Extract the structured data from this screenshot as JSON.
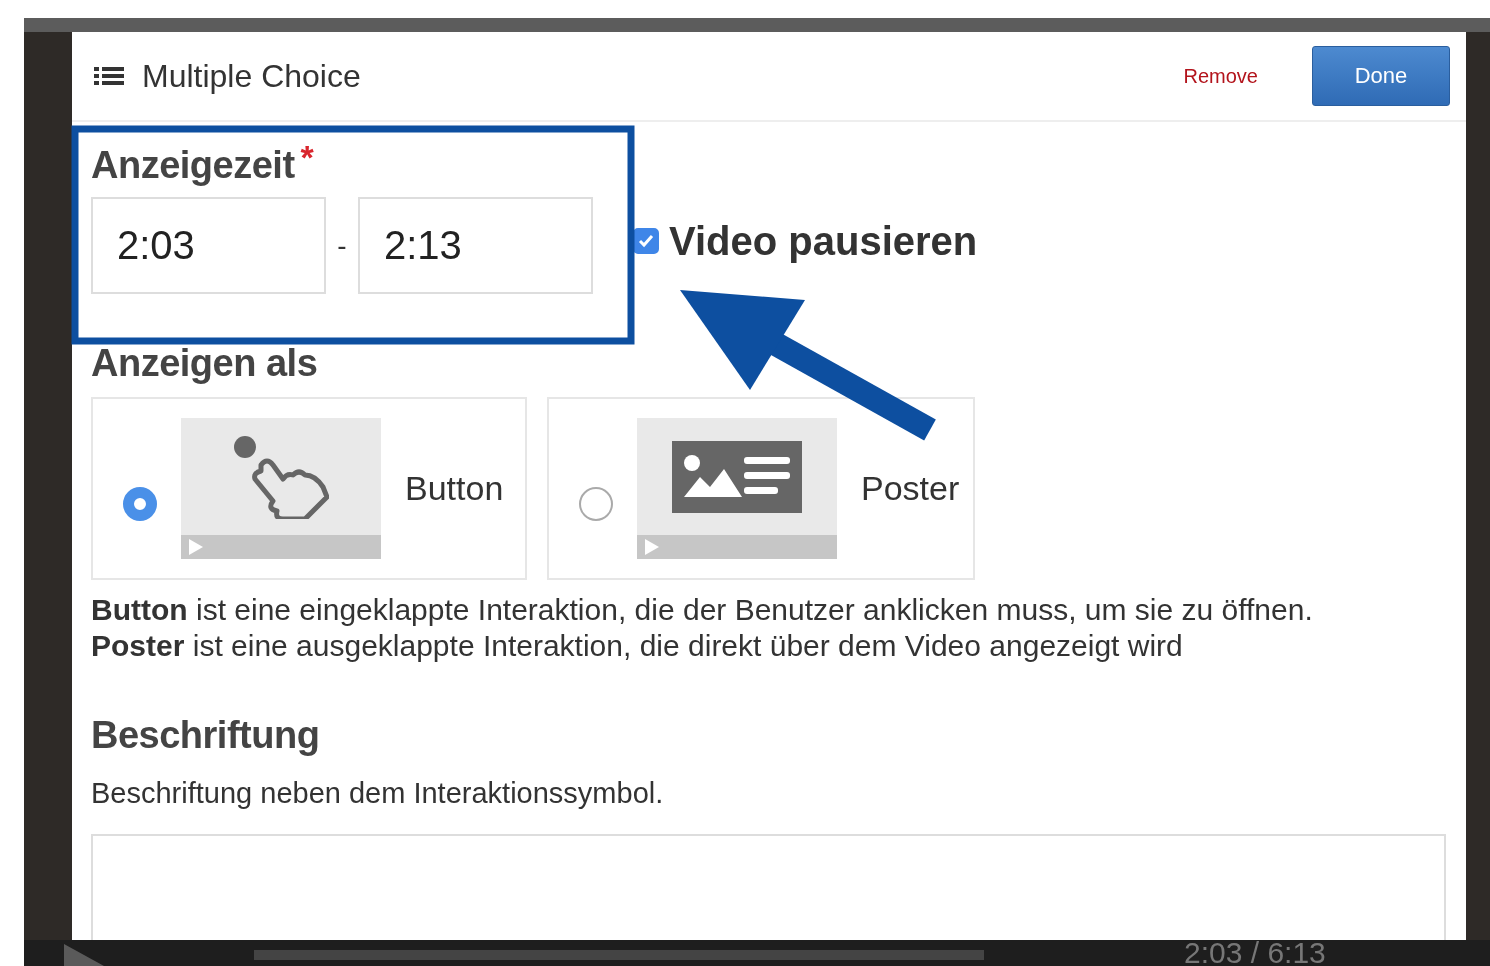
{
  "dialog": {
    "title": "Multiple Choice",
    "remove_button": "Remove",
    "done_button": "Done"
  },
  "display_time": {
    "label": "Anzeigezeit",
    "required_mark": "*",
    "start": "2:03",
    "separator": "-",
    "end": "2:13"
  },
  "pause_video": {
    "label": "Video pausieren",
    "checked": true
  },
  "display_as": {
    "label": "Anzeigen als",
    "options": [
      {
        "kind": "button",
        "label": "Button",
        "selected": true
      },
      {
        "kind": "poster",
        "label": "Poster",
        "selected": false
      }
    ],
    "help": [
      "**Button** ist eine eingeklappte Interaktion, die der Benutzer anklicken muss, um sie zu öffnen.",
      "**Poster** ist eine ausgeklappte Interaktion, die direkt über dem Video angezeigt wird"
    ]
  },
  "caption": {
    "label": "Beschriftung",
    "description": "Beschriftung neben dem Interaktionssymbol."
  },
  "player": {
    "time": "2:03 / 6:13"
  }
}
